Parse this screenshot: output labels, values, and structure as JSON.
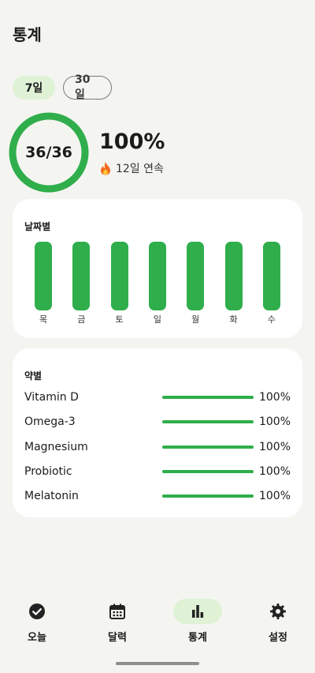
{
  "header": {
    "title": "통계"
  },
  "range_tabs": [
    {
      "label": "7일",
      "selected": true
    },
    {
      "label": "30일",
      "selected": false
    }
  ],
  "summary": {
    "count_text": "36/36",
    "percent_text": "100%",
    "progress_fraction": 1.0,
    "streak_icon": "fire-icon",
    "streak_text": "12일 연속"
  },
  "by_date": {
    "title": "날짜별",
    "days": [
      {
        "label": "목",
        "value": 100
      },
      {
        "label": "금",
        "value": 100
      },
      {
        "label": "토",
        "value": 100
      },
      {
        "label": "일",
        "value": 100
      },
      {
        "label": "월",
        "value": 100
      },
      {
        "label": "화",
        "value": 100
      },
      {
        "label": "수",
        "value": 100
      }
    ]
  },
  "by_med": {
    "title": "약별",
    "items": [
      {
        "name": "Vitamin D",
        "percent": 100,
        "percent_text": "100%"
      },
      {
        "name": "Omega-3",
        "percent": 100,
        "percent_text": "100%"
      },
      {
        "name": "Magnesium",
        "percent": 100,
        "percent_text": "100%"
      },
      {
        "name": "Probiotic",
        "percent": 100,
        "percent_text": "100%"
      },
      {
        "name": "Melatonin",
        "percent": 100,
        "percent_text": "100%"
      }
    ]
  },
  "nav": {
    "items": [
      {
        "label": "오늘",
        "icon": "check-circle-icon",
        "active": false
      },
      {
        "label": "달력",
        "icon": "calendar-icon",
        "active": false
      },
      {
        "label": "통계",
        "icon": "bar-chart-icon",
        "active": true
      },
      {
        "label": "설정",
        "icon": "gear-icon",
        "active": false
      }
    ]
  },
  "colors": {
    "accent": "#2fae4b",
    "accent_soft": "#dff2d6",
    "background": "#f4f5f1"
  }
}
